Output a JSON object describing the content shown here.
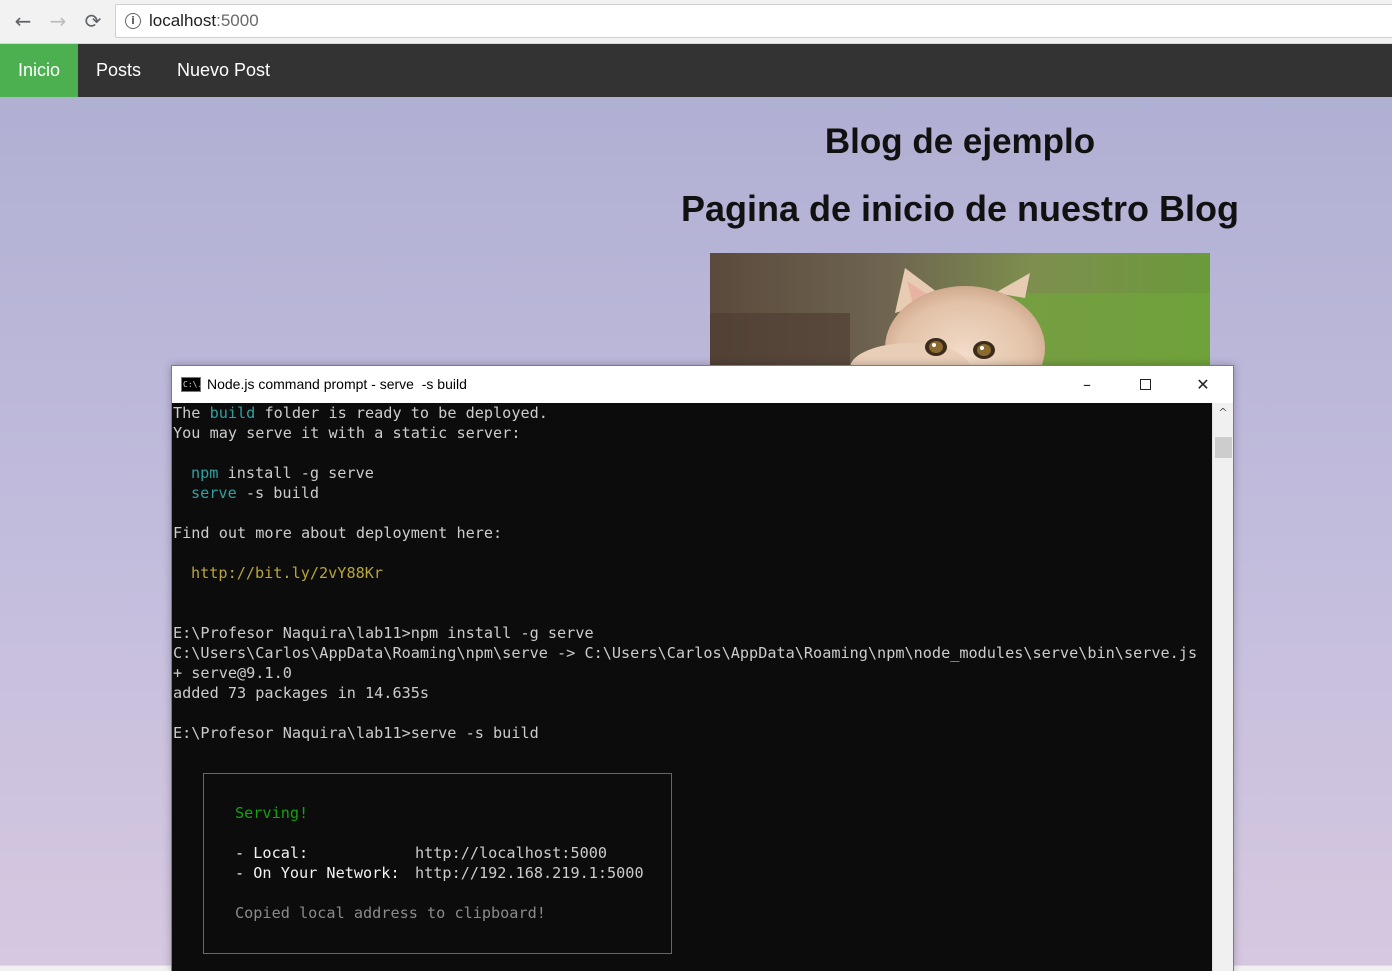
{
  "browser": {
    "back_icon": "←",
    "forward_icon": "→",
    "reload_icon": "⟳",
    "url_host": "localhost",
    "url_port": ":5000",
    "info_icon": "i"
  },
  "site": {
    "nav": [
      {
        "label": "Inicio",
        "active": true
      },
      {
        "label": "Posts",
        "active": false
      },
      {
        "label": "Nuevo Post",
        "active": false
      }
    ],
    "title": "Blog de ejemplo",
    "subtitle": "Pagina de inicio de nuestro Blog",
    "accent_color": "#4caf50"
  },
  "console_window": {
    "title": "Node.js command prompt - serve  -s build",
    "icon_text": "C:\\.",
    "minimize_glyph": "–",
    "close_glyph": "✕",
    "lines": {
      "l1a": "The ",
      "l1b": "build",
      "l1c": " folder is ready to be deployed.",
      "l2": "You may serve it with a static server:",
      "l3a": "npm",
      "l3b": " install -g serve",
      "l4a": "serve",
      "l4b": " -s build",
      "l5": "Find out more about deployment here:",
      "l6": "http://bit.ly/2vY88Kr",
      "l7": "E:\\Profesor Naquira\\lab11>npm install -g serve",
      "l8": "C:\\Users\\Carlos\\AppData\\Roaming\\npm\\serve -> C:\\Users\\Carlos\\AppData\\Roaming\\npm\\node_modules\\serve\\bin\\serve.js",
      "l9": "+ serve@9.1.0",
      "l10": "added 73 packages in 14.635s",
      "l11": "E:\\Profesor Naquira\\lab11>serve -s build",
      "serving": "Serving!",
      "local_label": "- Local:",
      "local_url": "http://localhost:5000",
      "network_label": "- On Your Network:",
      "network_url": "http://192.168.219.1:5000",
      "copied": "Copied local address to clipboard!"
    },
    "scroll_up_glyph": "^"
  }
}
